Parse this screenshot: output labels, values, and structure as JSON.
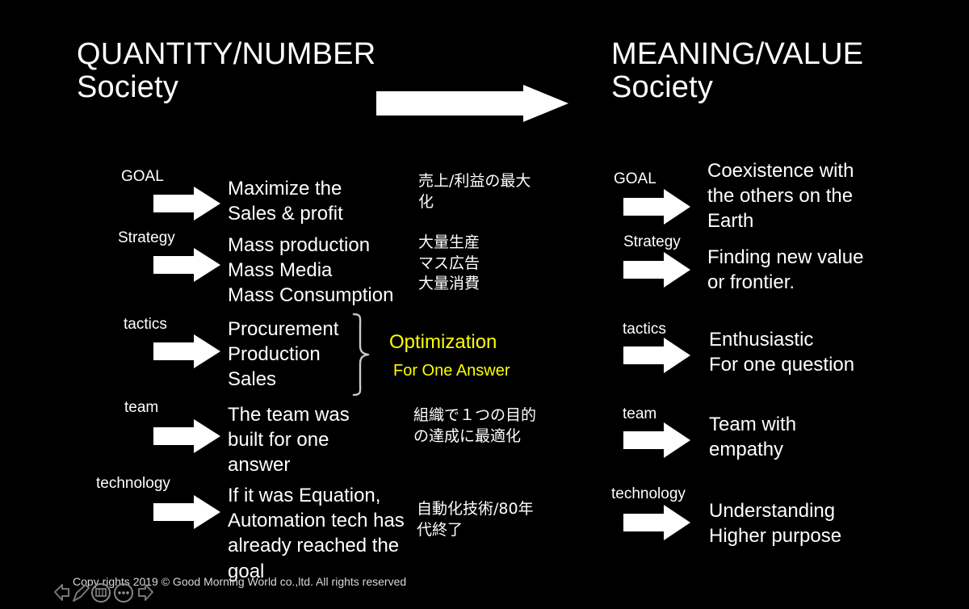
{
  "slide": {
    "background_color": "#000000",
    "text_color": "#ffffff",
    "accent_color": "#ffff00"
  },
  "left_column": {
    "title": "QUANTITY/NUMBER\nSociety",
    "rows": [
      {
        "label": "GOAL",
        "text": "Maximize the\nSales & profit"
      },
      {
        "label": "Strategy",
        "text": "Mass production\nMass Media\nMass Consumption"
      },
      {
        "label": "tactics",
        "text": "Procurement\nProduction\nSales"
      },
      {
        "label": "team",
        "text": "The team was\nbuilt for one\nanswer"
      },
      {
        "label": "technology",
        "text": "If it was Equation,\nAutomation tech has\nalready reached the\ngoal"
      }
    ]
  },
  "middle_column": {
    "annotations": [
      "売上/利益の最大\n化",
      "大量生産\nマス広告\n大量消費",
      "組織で１つの目的\nの達成に最適化",
      "自動化技術/80年\n代終了"
    ],
    "callout": {
      "main": "Optimization",
      "sub": "For One Answer",
      "color": "#ffff00"
    }
  },
  "right_column": {
    "title": "MEANING/VALUE\nSociety",
    "rows": [
      {
        "label": "GOAL",
        "text": "Coexistence with\nthe others on the\nEarth"
      },
      {
        "label": "Strategy",
        "text": "Finding new value\nor frontier."
      },
      {
        "label": "tactics",
        "text": "Enthusiastic\nFor one question"
      },
      {
        "label": "team",
        "text": "Team with\nempathy"
      },
      {
        "label": "technology",
        "text": "Understanding\nHigher purpose"
      }
    ]
  },
  "transition_arrow": {
    "icon": "right-block-arrow-icon"
  },
  "footer": {
    "copyright": "Copy rights 2019 © Good Morning World co.,ltd. All rights reserved"
  },
  "nav_controls": {
    "items": [
      {
        "icon": "previous-slide-arrow-icon"
      },
      {
        "icon": "pen-icon"
      },
      {
        "icon": "slide-grid-icon"
      },
      {
        "icon": "more-options-icon"
      },
      {
        "icon": "next-slide-arrow-icon"
      }
    ]
  }
}
